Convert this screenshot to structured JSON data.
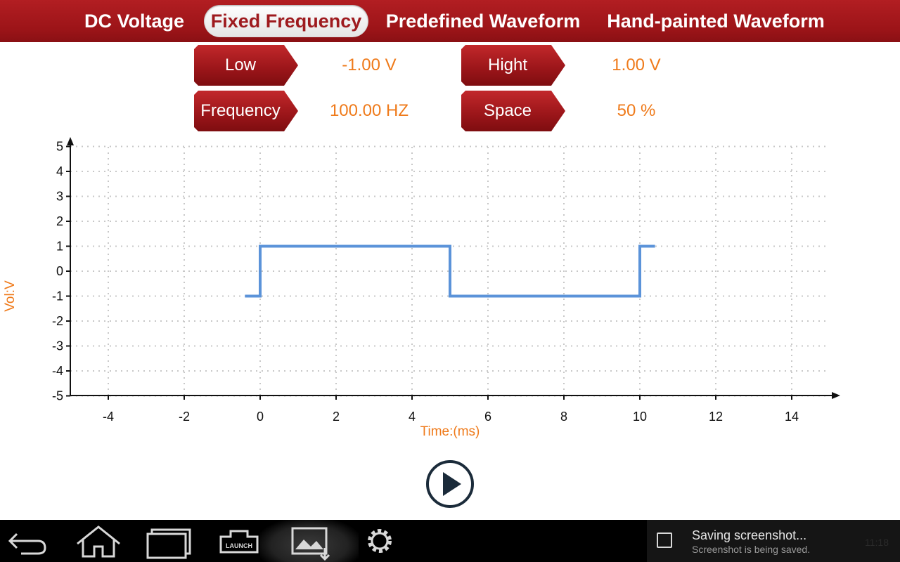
{
  "tabs": [
    {
      "label": "DC Voltage",
      "active": false
    },
    {
      "label": "Fixed Frequency",
      "active": true
    },
    {
      "label": "Predefined Waveform",
      "active": false
    },
    {
      "label": "Hand-painted Waveform",
      "active": false
    }
  ],
  "params": {
    "low": {
      "label": "Low",
      "value": "-1.00 V"
    },
    "high": {
      "label": "Hight",
      "value": "1.00 V"
    },
    "frequency": {
      "label": "Frequency",
      "value": "100.00 HZ"
    },
    "space": {
      "label": "Space",
      "value": "50 %"
    }
  },
  "chart_data": {
    "type": "line",
    "xlabel": "Time:(ms)",
    "ylabel": "Vol:V",
    "xlim": [
      -6,
      15
    ],
    "ylim": [
      -5,
      5
    ],
    "xticks": [
      -4,
      -2,
      0,
      2,
      4,
      6,
      8,
      10,
      12,
      14
    ],
    "yticks": [
      5,
      4,
      3,
      2,
      1,
      0,
      -1,
      -2,
      -3,
      -4,
      -5
    ],
    "grid": true,
    "series": [
      {
        "color": "#5b93d9",
        "x": [
          -0.4,
          0,
          0,
          5,
          5,
          10,
          10,
          10.4
        ],
        "y": [
          -1,
          -1,
          1,
          1,
          -1,
          -1,
          1,
          1
        ]
      }
    ]
  },
  "controls": {
    "play_icon": "play-icon"
  },
  "system_bar": {
    "buttons": [
      "back-icon",
      "home-icon",
      "recent-apps-icon",
      "launch-icon",
      "screenshot-icon",
      "settings-icon"
    ],
    "launch_label": "LAUNCH",
    "notification_title": "Saving screenshot...",
    "notification_subtitle": "Screenshot is being saved.",
    "time": "11:18"
  }
}
